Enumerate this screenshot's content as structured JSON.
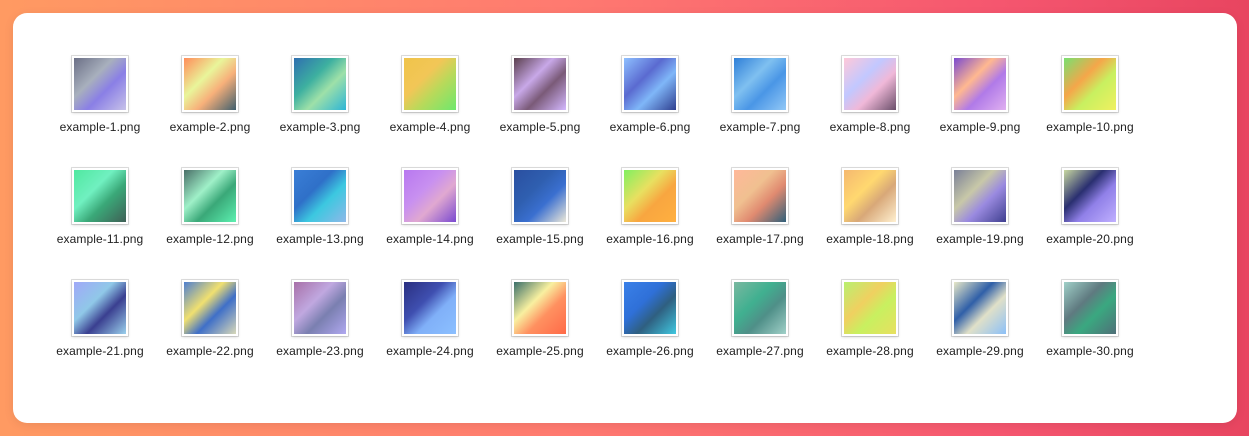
{
  "files": [
    {
      "name": "example-1.png",
      "c1": "#6b6f86",
      "c2": "#a8b0bd",
      "c3": "#8a7fe6",
      "c4": "#c7c2e8"
    },
    {
      "name": "example-2.png",
      "c1": "#ff8c5a",
      "c2": "#e9f59a",
      "c3": "#f7b07a",
      "c4": "#3f5f6e"
    },
    {
      "name": "example-3.png",
      "c1": "#2f6fb0",
      "c2": "#3db0a0",
      "c3": "#9ee0a8",
      "c4": "#2db5d6"
    },
    {
      "name": "example-4.png",
      "c1": "#f0c44a",
      "c2": "#f2c657",
      "c3": "#b9d95a",
      "c4": "#6ee86d"
    },
    {
      "name": "example-5.png",
      "c1": "#5a3f4d",
      "c2": "#c8a8e8",
      "c3": "#7a5a78",
      "c4": "#d4b8ff"
    },
    {
      "name": "example-6.png",
      "c1": "#8ec0ff",
      "c2": "#5a6ad0",
      "c3": "#7fb6f8",
      "c4": "#2f3f8f"
    },
    {
      "name": "example-7.png",
      "c1": "#2f7fd8",
      "c2": "#7fc0f0",
      "c3": "#4a96e6",
      "c4": "#92c8f6"
    },
    {
      "name": "example-8.png",
      "c1": "#ffc8d8",
      "c2": "#c2c8ff",
      "c3": "#f0b8d8",
      "c4": "#6a4f6a"
    },
    {
      "name": "example-9.png",
      "c1": "#7a4ad0",
      "c2": "#ffb890",
      "c3": "#b07ae8",
      "c4": "#e0b0f0"
    },
    {
      "name": "example-10.png",
      "c1": "#78e070",
      "c2": "#f5a64a",
      "c3": "#c8f060",
      "c4": "#f0f060"
    },
    {
      "name": "example-11.png",
      "c1": "#50e8a0",
      "c2": "#70f0c0",
      "c3": "#3aa878",
      "c4": "#3f5f55"
    },
    {
      "name": "example-12.png",
      "c1": "#4a6f68",
      "c2": "#9ff0c8",
      "c3": "#3aa878",
      "c4": "#5cf0b0"
    },
    {
      "name": "example-13.png",
      "c1": "#3a7ed6",
      "c2": "#2f70c8",
      "c3": "#3cc8e0",
      "c4": "#8fb8e8"
    },
    {
      "name": "example-14.png",
      "c1": "#b878f0",
      "c2": "#c890f0",
      "c3": "#e0a8d0",
      "c4": "#7a4ad0"
    },
    {
      "name": "example-15.png",
      "c1": "#2a4fa0",
      "c2": "#2f5fb0",
      "c3": "#3a6fd0",
      "c4": "#ece8d8"
    },
    {
      "name": "example-16.png",
      "c1": "#80f060",
      "c2": "#e8e060",
      "c3": "#f8a640",
      "c4": "#ffb040"
    },
    {
      "name": "example-17.png",
      "c1": "#ffb89a",
      "c2": "#f0c090",
      "c3": "#e08a70",
      "c4": "#2f5f7a"
    },
    {
      "name": "example-18.png",
      "c1": "#f5b870",
      "c2": "#ffd870",
      "c3": "#d8a878",
      "c4": "#fff0d0"
    },
    {
      "name": "example-19.png",
      "c1": "#7a8098",
      "c2": "#c8c8a8",
      "c3": "#9a8ae0",
      "c4": "#3f3f8f"
    },
    {
      "name": "example-20.png",
      "c1": "#c8d8a0",
      "c2": "#2a2f70",
      "c3": "#9080e8",
      "c4": "#c0b0ff"
    },
    {
      "name": "example-21.png",
      "c1": "#a0a8f8",
      "c2": "#90c8e8",
      "c3": "#3a3f90",
      "c4": "#9ad0ec"
    },
    {
      "name": "example-22.png",
      "c1": "#4f7fd0",
      "c2": "#f0e070",
      "c3": "#3f6fc8",
      "c4": "#d8d8b8"
    },
    {
      "name": "example-23.png",
      "c1": "#a870a8",
      "c2": "#c0a8e0",
      "c3": "#7a7fb0",
      "c4": "#b0a8f0"
    },
    {
      "name": "example-24.png",
      "c1": "#2a2f80",
      "c2": "#3f4fb0",
      "c3": "#80b0f8",
      "c4": "#8cc0ff"
    },
    {
      "name": "example-25.png",
      "c1": "#3a6f6a",
      "c2": "#f8f0a0",
      "c3": "#ff9060",
      "c4": "#ff6a48"
    },
    {
      "name": "example-26.png",
      "c1": "#3a80e8",
      "c2": "#2f70d8",
      "c3": "#2f5f80",
      "c4": "#40c8e0"
    },
    {
      "name": "example-27.png",
      "c1": "#7ab8a0",
      "c2": "#40b090",
      "c3": "#4f8f88",
      "c4": "#a0d0c8"
    },
    {
      "name": "example-28.png",
      "c1": "#b8f070",
      "c2": "#f0d060",
      "c3": "#c8f060",
      "c4": "#e8e060"
    },
    {
      "name": "example-29.png",
      "c1": "#e8e8c8",
      "c2": "#2f5fa8",
      "c3": "#e0e0c8",
      "c4": "#8cc0f8"
    },
    {
      "name": "example-30.png",
      "c1": "#a0d0c8",
      "c2": "#5f7a80",
      "c3": "#3aa880",
      "c4": "#4f6f78"
    }
  ]
}
